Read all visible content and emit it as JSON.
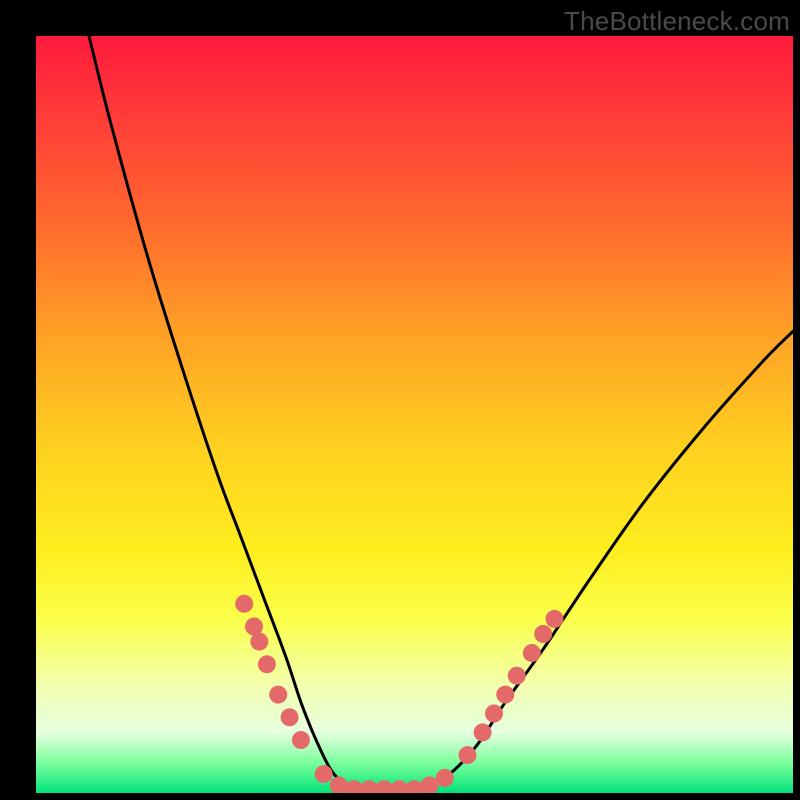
{
  "watermark": "TheBottleneck.com",
  "chart_data": {
    "type": "line",
    "title": "",
    "xlabel": "",
    "ylabel": "",
    "xlim": [
      0,
      100
    ],
    "ylim": [
      0,
      100
    ],
    "grid": false,
    "series": [
      {
        "name": "bottleneck-curve",
        "x": [
          7,
          10,
          15,
          20,
          24,
          27,
          30,
          33,
          35,
          37,
          39,
          41,
          43,
          46,
          50,
          54,
          58,
          62,
          67,
          73,
          80,
          88,
          96,
          100
        ],
        "values": [
          100,
          88,
          70,
          54,
          42,
          34,
          26,
          18,
          12,
          7,
          3,
          1,
          0,
          0,
          0,
          2,
          6,
          12,
          19,
          28,
          38,
          48,
          57,
          61
        ]
      }
    ],
    "markers": {
      "name": "highlight-dots",
      "color": "#e46a6a",
      "points": [
        {
          "x": 27.5,
          "y": 25
        },
        {
          "x": 28.8,
          "y": 22
        },
        {
          "x": 29.5,
          "y": 20
        },
        {
          "x": 30.5,
          "y": 17
        },
        {
          "x": 32.0,
          "y": 13
        },
        {
          "x": 33.5,
          "y": 10
        },
        {
          "x": 35.0,
          "y": 7
        },
        {
          "x": 38.0,
          "y": 2.5
        },
        {
          "x": 40.0,
          "y": 1.0
        },
        {
          "x": 42.0,
          "y": 0.5
        },
        {
          "x": 44.0,
          "y": 0.5
        },
        {
          "x": 46.0,
          "y": 0.5
        },
        {
          "x": 48.0,
          "y": 0.5
        },
        {
          "x": 50.0,
          "y": 0.5
        },
        {
          "x": 52.0,
          "y": 1.0
        },
        {
          "x": 54.0,
          "y": 2.0
        },
        {
          "x": 57.0,
          "y": 5.0
        },
        {
          "x": 59.0,
          "y": 8.0
        },
        {
          "x": 60.5,
          "y": 10.5
        },
        {
          "x": 62.0,
          "y": 13.0
        },
        {
          "x": 63.5,
          "y": 15.5
        },
        {
          "x": 65.5,
          "y": 18.5
        },
        {
          "x": 67.0,
          "y": 21.0
        },
        {
          "x": 68.5,
          "y": 23.0
        }
      ]
    },
    "gradient_stops": [
      {
        "offset": 0,
        "color": "#ff1a3c"
      },
      {
        "offset": 25,
        "color": "#ff6a2d"
      },
      {
        "offset": 55,
        "color": "#ffd21f"
      },
      {
        "offset": 86,
        "color": "#f2ffb0"
      },
      {
        "offset": 100,
        "color": "#00e27a"
      }
    ]
  }
}
